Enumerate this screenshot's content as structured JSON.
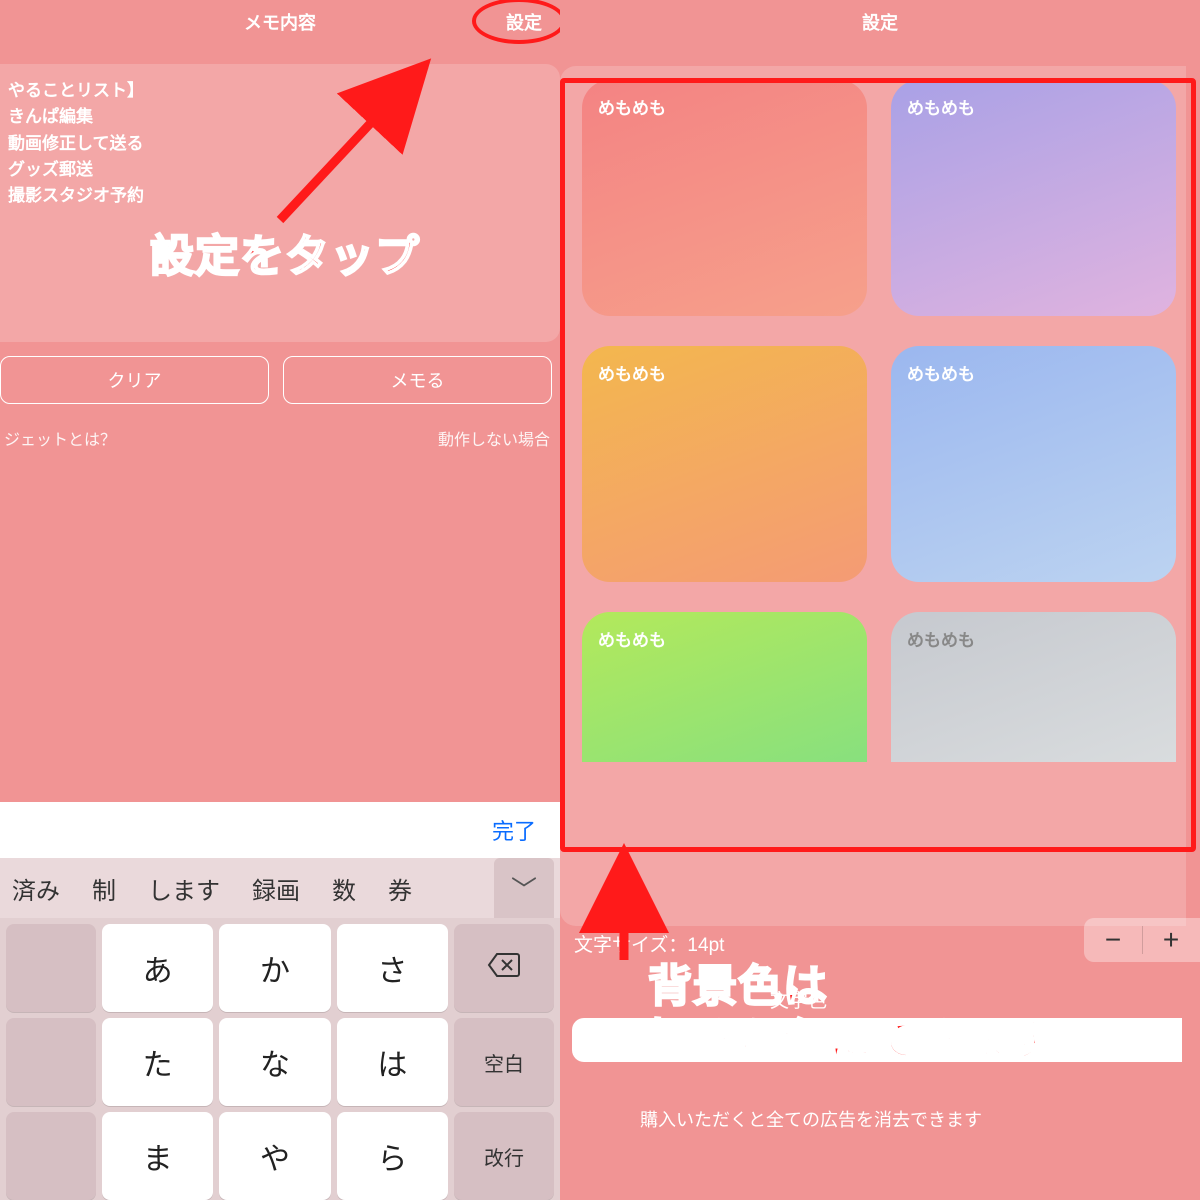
{
  "left": {
    "title": "メモ内容",
    "settings_link": "設定",
    "memo_lines": [
      "やることリスト】",
      "きんぱ編集",
      "動画修正して送る",
      "グッズ郵送",
      "撮影スタジオ予約"
    ],
    "clear_btn": "クリア",
    "memo_btn": "メモる",
    "hint_left": "ジェットとは？",
    "hint_right": "動作しない場合",
    "annotation": "設定をタップ"
  },
  "keyboard": {
    "done": "完了",
    "suggestions": [
      "済み",
      "制",
      "します",
      "録画",
      "数",
      "券"
    ],
    "rows": [
      [
        "",
        "あ",
        "か",
        "さ",
        "del"
      ],
      [
        "",
        "た",
        "な",
        "は",
        "空白"
      ],
      [
        "",
        "ま",
        "や",
        "ら",
        "改行"
      ]
    ],
    "space_label": "空白",
    "return_label": "改行"
  },
  "right": {
    "title": "設定",
    "swatch_label": "めもめも",
    "font_size_label": "文字サイズ：14pt",
    "minus": "−",
    "plus": "+",
    "text_color_label": "文字色",
    "purchase_note": "購入いただくと全ての広告を消去できます",
    "annotation_line1": "背景色は",
    "annotation_line2": "好きな色にできます"
  }
}
